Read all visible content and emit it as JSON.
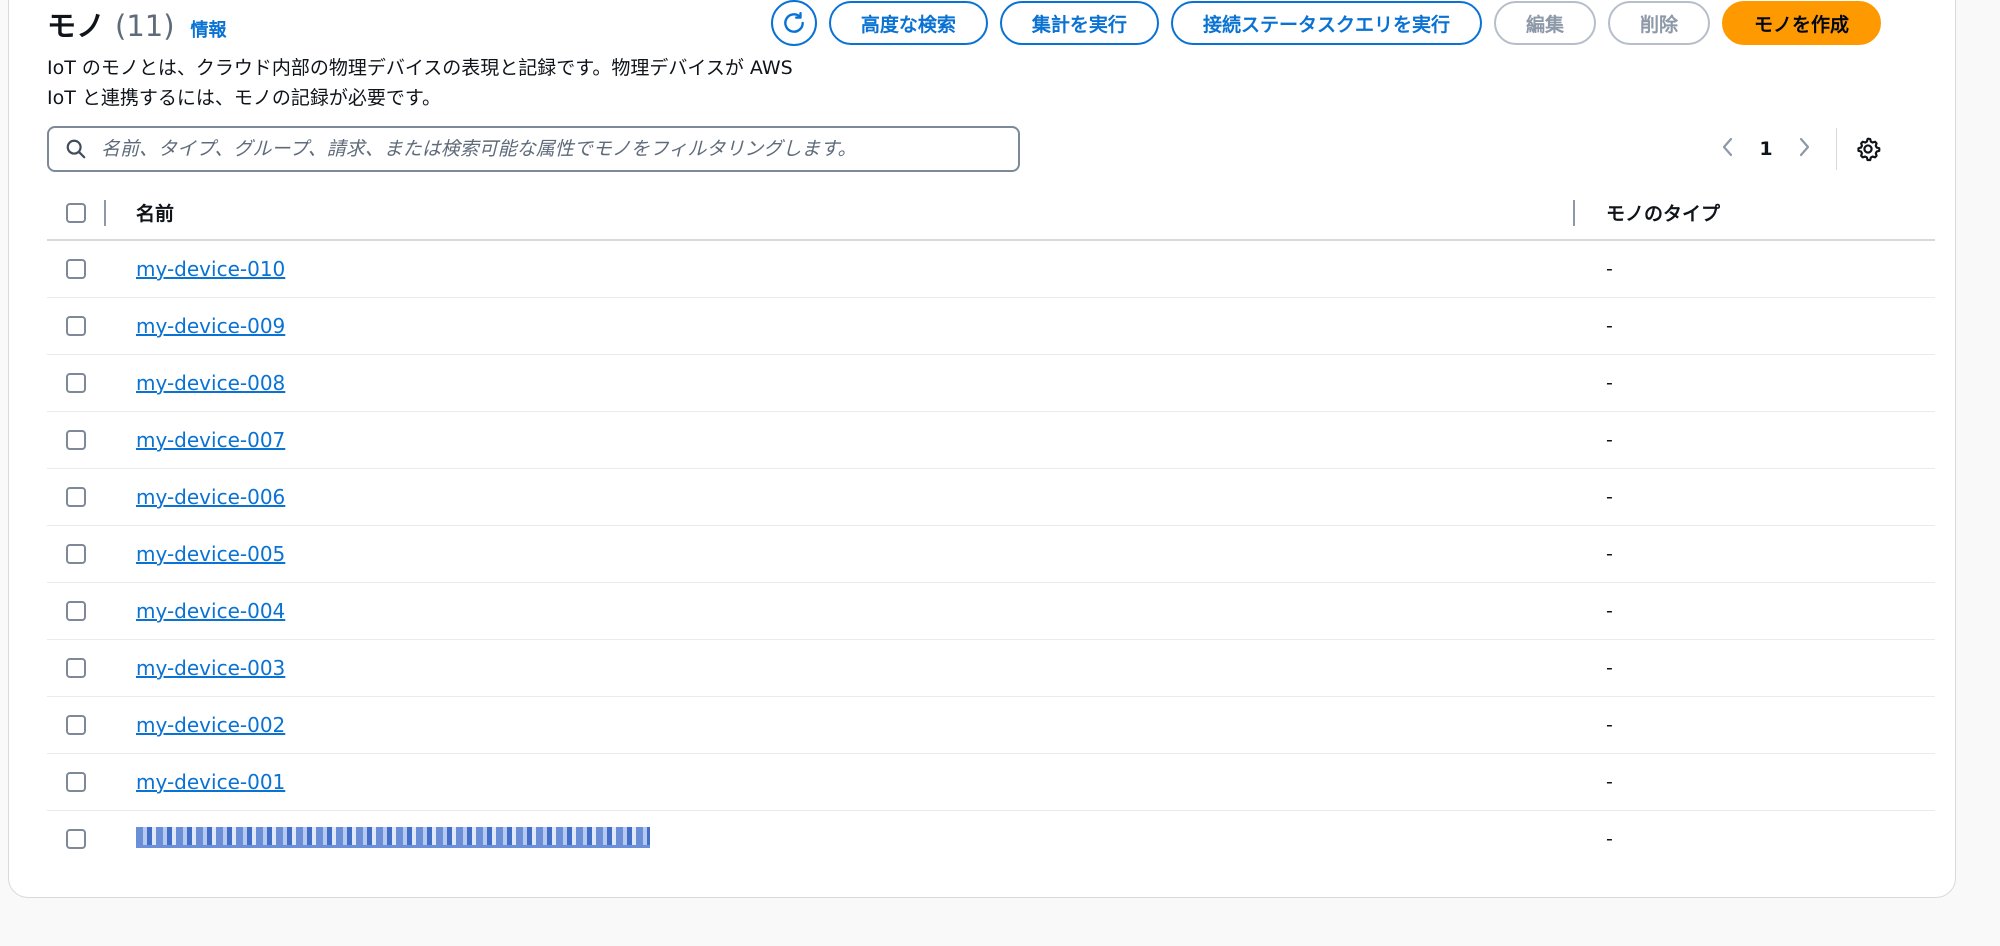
{
  "header": {
    "title": "モノ",
    "count": "(11)",
    "info_link": "情報",
    "description_line1": "IoT のモノとは、クラウド内部の物理デバイスの表現と記録です。物理デバイスが AWS",
    "description_line2": "IoT と連携するには、モノの記録が必要です。"
  },
  "actions": {
    "refresh_icon": "refresh-icon",
    "advanced_search": "高度な検索",
    "run_aggregation": "集計を実行",
    "run_connectivity_query": "接続ステータスクエリを実行",
    "edit": "編集",
    "delete": "削除",
    "create": "モノを作成"
  },
  "search": {
    "placeholder": "名前、タイプ、グループ、請求、または検索可能な属性でモノをフィルタリングします。"
  },
  "pagination": {
    "current_page": "1"
  },
  "table": {
    "columns": [
      "名前",
      "モノのタイプ"
    ],
    "rows": [
      {
        "name": "my-device-010",
        "type": "-"
      },
      {
        "name": "my-device-009",
        "type": "-"
      },
      {
        "name": "my-device-008",
        "type": "-"
      },
      {
        "name": "my-device-007",
        "type": "-"
      },
      {
        "name": "my-device-006",
        "type": "-"
      },
      {
        "name": "my-device-005",
        "type": "-"
      },
      {
        "name": "my-device-004",
        "type": "-"
      },
      {
        "name": "my-device-003",
        "type": "-"
      },
      {
        "name": "my-device-002",
        "type": "-"
      },
      {
        "name": "my-device-001",
        "type": "-"
      },
      {
        "name": "",
        "type": "-",
        "redacted": true
      }
    ]
  },
  "colors": {
    "link": "#0972d3",
    "primary_button": "#ff9900",
    "disabled": "#8d99a8"
  }
}
